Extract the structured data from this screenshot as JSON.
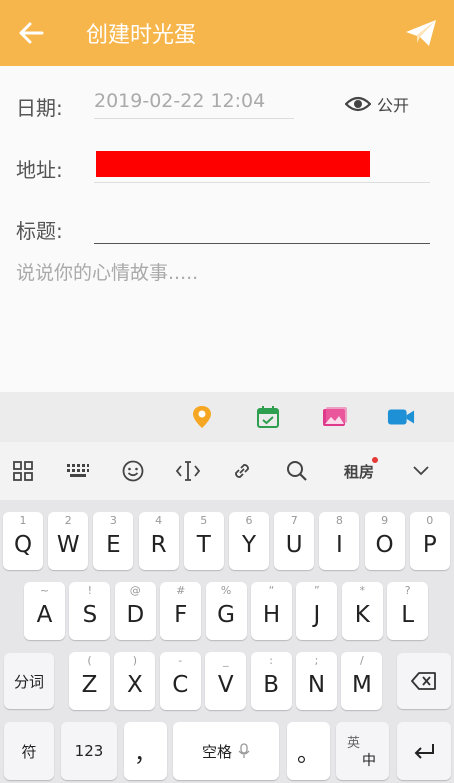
{
  "header": {
    "title": "创建时光蛋",
    "back_icon": "arrow-left-icon",
    "send_icon": "paper-plane-icon",
    "color": "#f7b64b"
  },
  "form": {
    "date_label": "日期:",
    "date_value": "2019-02-22 12:04",
    "visibility_label": "公开",
    "address_label": "地址:",
    "title_label": "标题:",
    "story_placeholder": "说说你的心情故事....."
  },
  "attach_bar": {
    "icons": [
      "location-pin-icon",
      "calendar-check-icon",
      "image-icon",
      "video-camera-icon"
    ],
    "colors": [
      "#f5a623",
      "#2e9e4f",
      "#e0388b",
      "#1e90d6"
    ]
  },
  "kb_toolbar": {
    "icons": [
      "grid-apps-icon",
      "keyboard-icon",
      "emoji-icon",
      "cursor-icon",
      "link-icon",
      "search-icon",
      "handwriting-icon",
      "chevron-down-icon"
    ],
    "handwrite_label": "租房"
  },
  "keyboard": {
    "row1": [
      {
        "k": "Q",
        "h": "1"
      },
      {
        "k": "W",
        "h": "2"
      },
      {
        "k": "E",
        "h": "3"
      },
      {
        "k": "R",
        "h": "4"
      },
      {
        "k": "T",
        "h": "5"
      },
      {
        "k": "Y",
        "h": "6"
      },
      {
        "k": "U",
        "h": "7"
      },
      {
        "k": "I",
        "h": "8"
      },
      {
        "k": "O",
        "h": "9"
      },
      {
        "k": "P",
        "h": "0"
      }
    ],
    "row2": [
      {
        "k": "A",
        "h": "~"
      },
      {
        "k": "S",
        "h": "!"
      },
      {
        "k": "D",
        "h": "@"
      },
      {
        "k": "F",
        "h": "#"
      },
      {
        "k": "G",
        "h": "%"
      },
      {
        "k": "H",
        "h": "“"
      },
      {
        "k": "J",
        "h": "”"
      },
      {
        "k": "K",
        "h": "*"
      },
      {
        "k": "L",
        "h": "?"
      }
    ],
    "row3": [
      {
        "k": "Z",
        "h": "("
      },
      {
        "k": "X",
        "h": ")"
      },
      {
        "k": "C",
        "h": "-"
      },
      {
        "k": "V",
        "h": "_"
      },
      {
        "k": "B",
        "h": ":"
      },
      {
        "k": "N",
        "h": ";"
      },
      {
        "k": "M",
        "h": "/"
      }
    ],
    "split_label": "分词",
    "symbol_label": "符",
    "num_label": "123",
    "comma_label": "，",
    "space_label": "空格",
    "period_label": "。",
    "lang_top": "英",
    "lang_bottom": "中"
  }
}
